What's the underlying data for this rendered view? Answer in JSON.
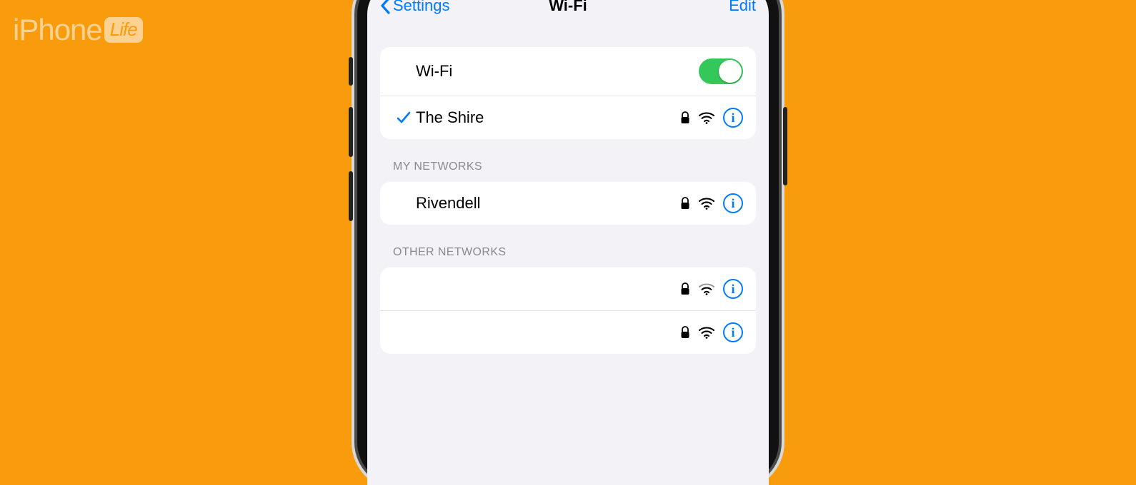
{
  "watermark": {
    "brand": "iPhone",
    "sub": "Life"
  },
  "navbar": {
    "back_label": "Settings",
    "title": "Wi-Fi",
    "edit_label": "Edit"
  },
  "wifi_toggle": {
    "label": "Wi-Fi",
    "enabled": true
  },
  "connected_network": {
    "name": "The Shire",
    "secured": true,
    "checked": true
  },
  "sections": {
    "my_networks_header": "MY NETWORKS",
    "other_networks_header": "OTHER NETWORKS"
  },
  "my_networks": [
    {
      "name": "Rivendell",
      "secured": true,
      "signal": "strong"
    }
  ],
  "other_networks": [
    {
      "name": "(redacted)",
      "secured": true,
      "signal": "medium",
      "blurred": true
    },
    {
      "name": "(redacted)",
      "secured": true,
      "signal": "strong",
      "blurred": true
    }
  ],
  "colors": {
    "accent": "#007aff",
    "toggle_on": "#34c759",
    "bg": "#f89c0e"
  }
}
